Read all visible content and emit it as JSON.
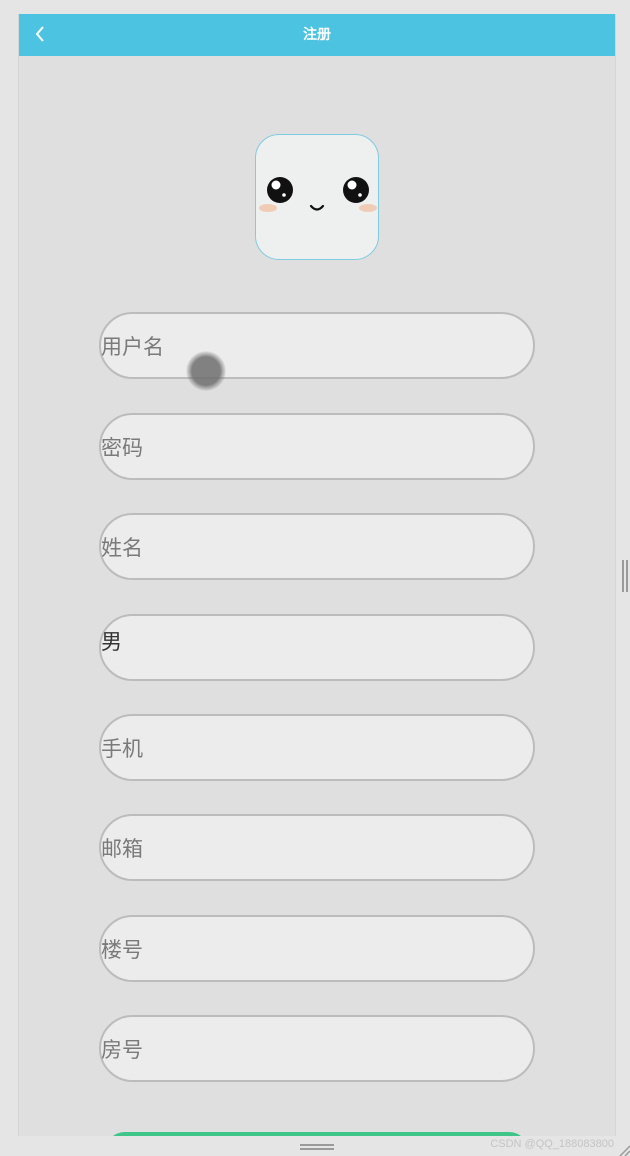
{
  "header": {
    "title": "注册",
    "back_icon": "chevron-left-icon",
    "background_color": "#4cc3e1"
  },
  "avatar": {
    "icon": "cute-face-avatar-icon",
    "border_color": "#7fcbe0"
  },
  "form": {
    "username_placeholder": "用户名",
    "password_placeholder": "密码",
    "name_placeholder": "姓名",
    "gender_value": "男",
    "phone_placeholder": "手机",
    "email_placeholder": "邮箱",
    "building_placeholder": "楼号",
    "room_placeholder": "房号"
  },
  "submit": {
    "color": "#3fc48a"
  },
  "watermark": "CSDN @QQ_188083800"
}
